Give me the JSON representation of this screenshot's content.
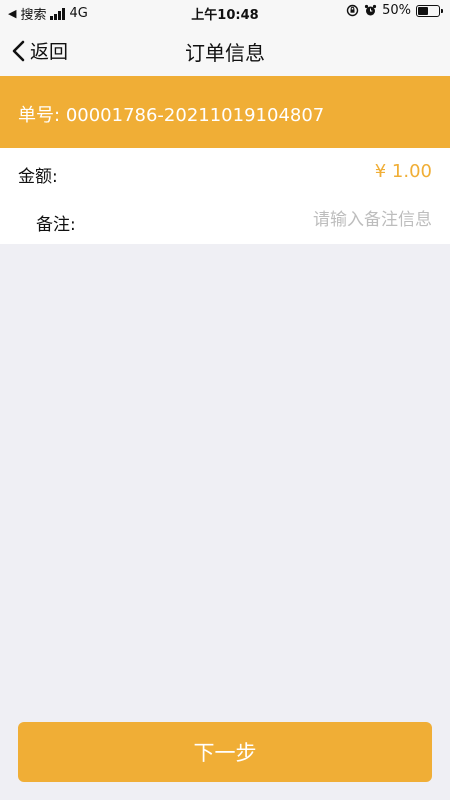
{
  "status_bar": {
    "back_app": "搜索",
    "network": "4G",
    "time": "上午10:48",
    "battery": "50%",
    "battery_level": 0.5
  },
  "nav": {
    "back_label": "返回",
    "title": "订单信息"
  },
  "order": {
    "number_label": "单号:",
    "number": "00001786-20211019104807"
  },
  "form": {
    "amount_label": "金额:",
    "amount_value": "¥ 1.00",
    "remark_label": "备注:",
    "remark_placeholder": "请输入备注信息",
    "remark_value": ""
  },
  "footer": {
    "next_label": "下一步"
  },
  "colors": {
    "accent": "#f0ae36",
    "bar_bg": "#f7f7f7",
    "page_bg": "#efeff4",
    "placeholder": "#bdbdbd"
  },
  "icons": [
    "back-triangle-icon",
    "signal-icon",
    "lock-rotation-icon",
    "alarm-icon",
    "battery-icon",
    "chevron-left-icon"
  ]
}
